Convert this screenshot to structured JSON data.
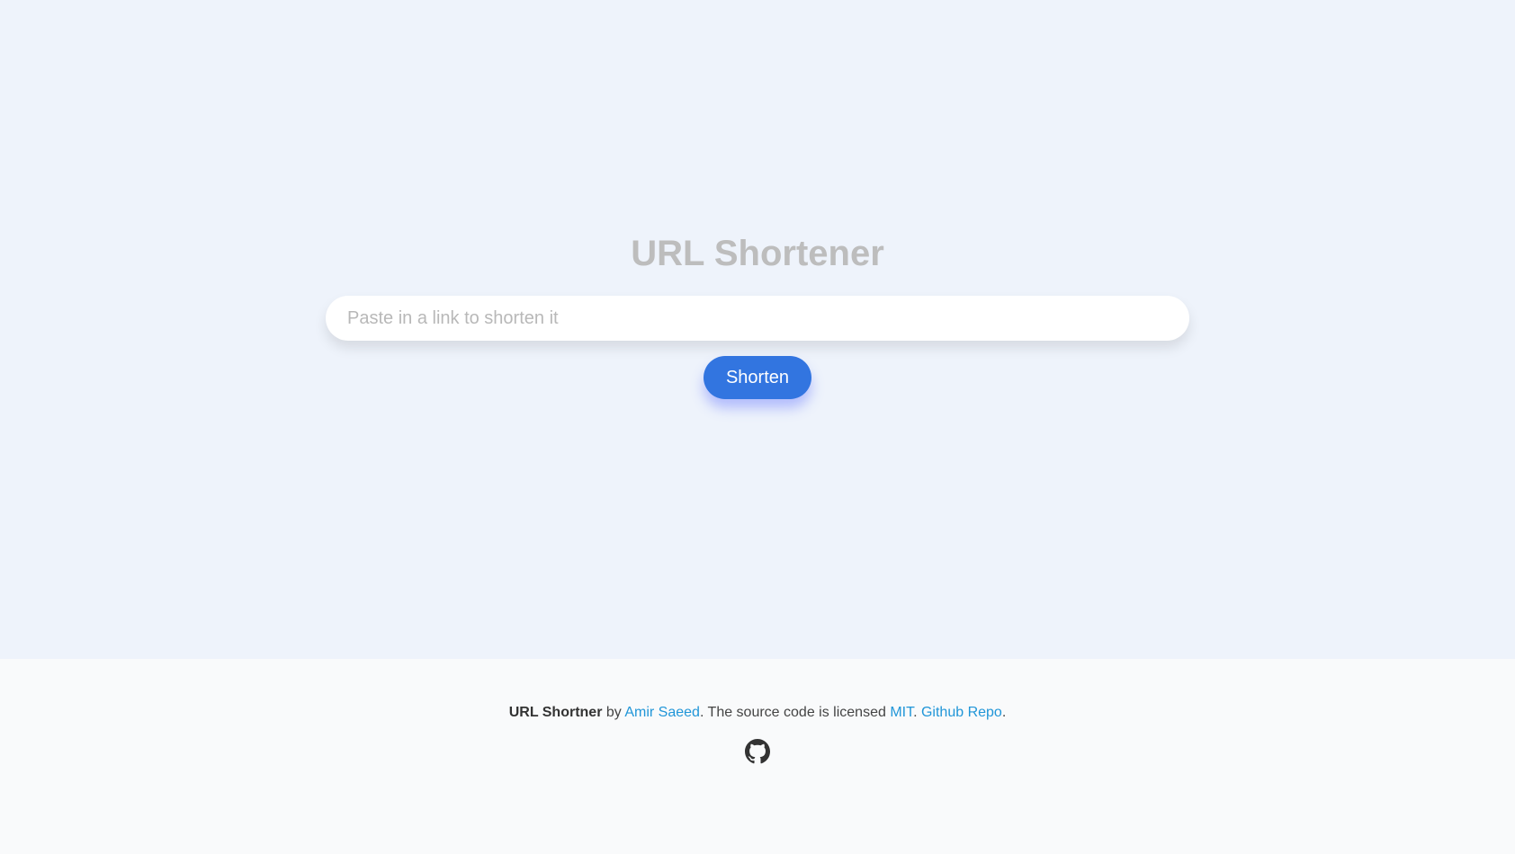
{
  "hero": {
    "title": "URL Shortener",
    "input_placeholder": "Paste in a link to shorten it",
    "input_value": "",
    "button_label": "Shorten"
  },
  "footer": {
    "app_name": "URL Shortner",
    "by_text": " by ",
    "author_link": "Amir Saeed",
    "middle_text": ". The source code is licensed ",
    "license_link": "MIT",
    "sep_text": ". ",
    "repo_link": "Github Repo",
    "end_text": ".",
    "icon": "github-icon"
  },
  "colors": {
    "hero_bg": "#eef3fb",
    "footer_bg": "#f9fafb",
    "button_bg": "#3275e0",
    "link": "#2196d8",
    "title": "#bdbdbd"
  }
}
